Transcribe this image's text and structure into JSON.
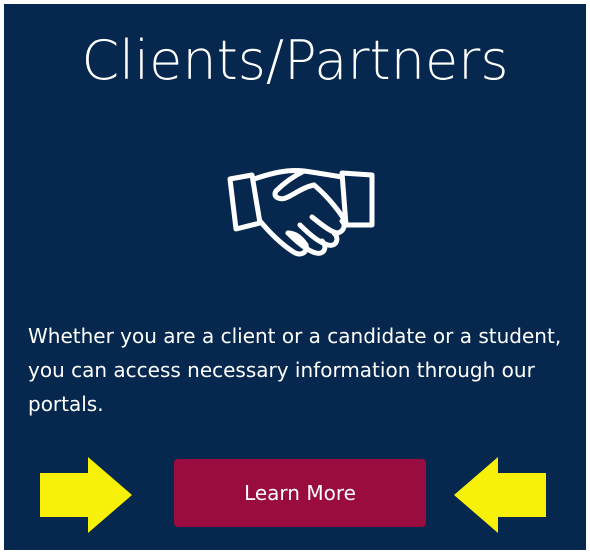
{
  "card": {
    "title": "Clients/Partners",
    "icon": "handshake-icon",
    "description": "Whether you are a client or a candidate or a student, you can access necessary information through our portals.",
    "button_label": "Learn More"
  },
  "annotations": {
    "left_arrow_icon": "arrow-right-icon",
    "right_arrow_icon": "arrow-left-icon"
  },
  "colors": {
    "background": "#06284f",
    "button": "#9a0b3f",
    "text": "#ffffff",
    "arrow": "#f7f008"
  }
}
